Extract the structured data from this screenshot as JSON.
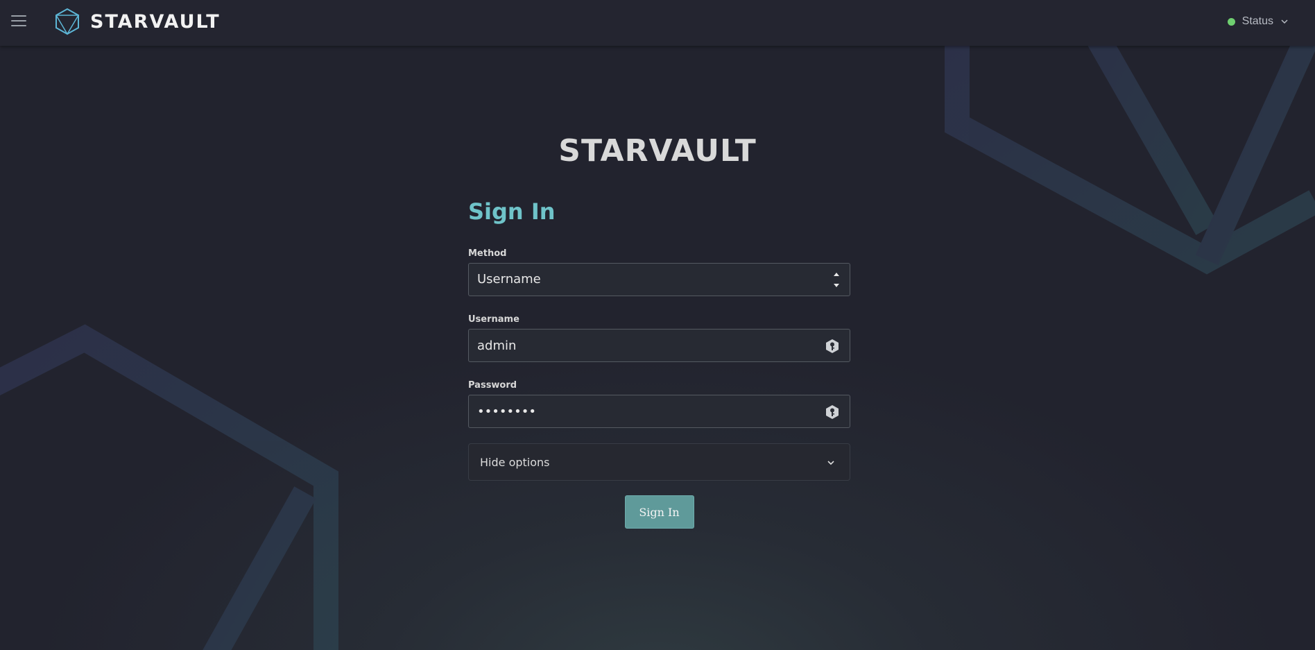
{
  "header": {
    "brand": "STARVAULT",
    "status_label": "Status",
    "status_color": "#6fcf70"
  },
  "wordmark": "STARVAULT",
  "form": {
    "title": "Sign In",
    "method": {
      "label": "Method",
      "value": "Username"
    },
    "username": {
      "label": "Username",
      "value": "admin"
    },
    "password": {
      "label": "Password",
      "value": "••••••••"
    },
    "options_label": "Hide options",
    "submit_label": "Sign In"
  },
  "colors": {
    "accent": "#6fc3c9",
    "button": "#5f9a9a"
  },
  "icons": [
    "menu-icon",
    "starvault-logo-icon",
    "chevron-down-icon",
    "spinner-arrows-icon",
    "key-icon"
  ]
}
